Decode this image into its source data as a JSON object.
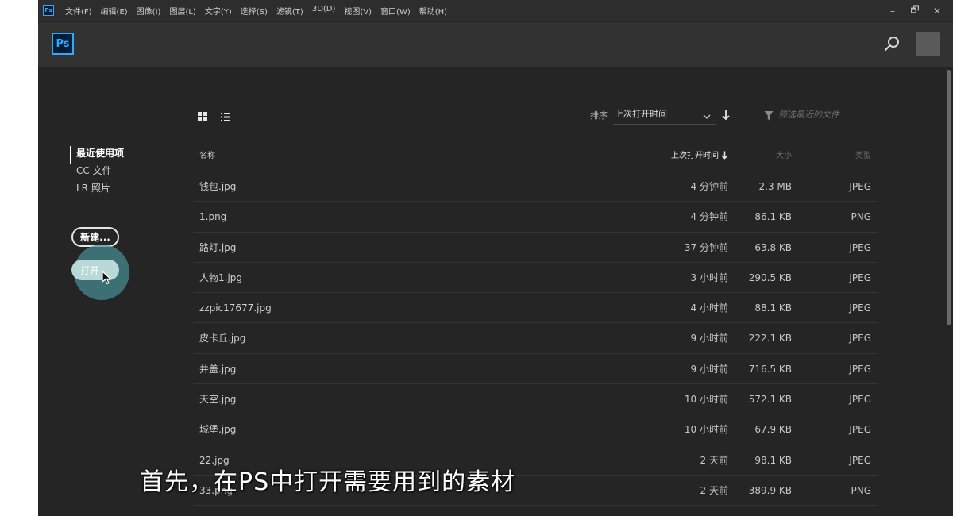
{
  "menu": {
    "app_icon": "Ps",
    "items": [
      "文件(F)",
      "编辑(E)",
      "图像(I)",
      "图层(L)",
      "文字(Y)",
      "选择(S)",
      "滤镜(T)",
      "3D(D)",
      "视图(V)",
      "窗口(W)",
      "帮助(H)"
    ],
    "window_controls": [
      "–",
      "🗗",
      "✕"
    ]
  },
  "header": {
    "logo": "Ps"
  },
  "sidebar": {
    "nav": [
      "最近使用项",
      "CC 文件",
      "LR 照片"
    ],
    "new_button": "新建...",
    "open_button": "打开"
  },
  "toolbar": {
    "sort_label": "排序",
    "sort_value": "上次打开时间",
    "filter_placeholder": "筛选最近的文件"
  },
  "table": {
    "headers": {
      "name": "名称",
      "date": "上次打开时间",
      "size": "大小",
      "type": "类型"
    },
    "rows": [
      {
        "name": "钱包.jpg",
        "date": "4 分钟前",
        "size": "2.3 MB",
        "type": "JPEG"
      },
      {
        "name": "1.png",
        "date": "4 分钟前",
        "size": "86.1 KB",
        "type": "PNG"
      },
      {
        "name": "路灯.jpg",
        "date": "37 分钟前",
        "size": "63.8 KB",
        "type": "JPEG"
      },
      {
        "name": "人物1.jpg",
        "date": "3 小时前",
        "size": "290.5 KB",
        "type": "JPEG"
      },
      {
        "name": "zzpic17677.jpg",
        "date": "4 小时前",
        "size": "88.1 KB",
        "type": "JPEG"
      },
      {
        "name": "皮卡丘.jpg",
        "date": "9 小时前",
        "size": "222.1 KB",
        "type": "JPEG"
      },
      {
        "name": "井盖.jpg",
        "date": "9 小时前",
        "size": "716.5 KB",
        "type": "JPEG"
      },
      {
        "name": "天空.jpg",
        "date": "10 小时前",
        "size": "572.1 KB",
        "type": "JPEG"
      },
      {
        "name": "城堡.jpg",
        "date": "10 小时前",
        "size": "67.9 KB",
        "type": "JPEG"
      },
      {
        "name": "22.jpg",
        "date": "2 天前",
        "size": "98.1 KB",
        "type": "JPEG"
      },
      {
        "name": "33.png",
        "date": "2 天前",
        "size": "389.9 KB",
        "type": "PNG"
      }
    ]
  },
  "caption": "首先，在PS中打开需要用到的素材",
  "colors": {
    "accent": "#31a8ff",
    "background": "#252525",
    "halo": "#479096"
  }
}
